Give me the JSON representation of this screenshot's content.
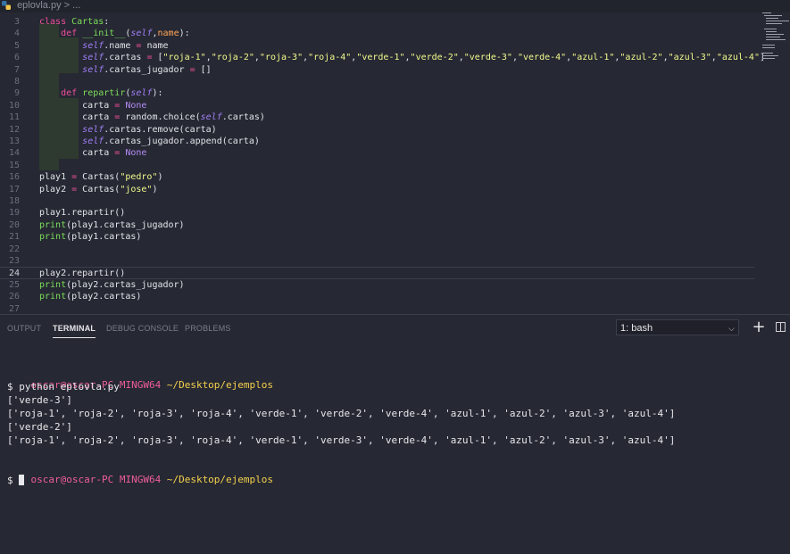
{
  "breadcrumb": {
    "file": "eplovla.py",
    "sep": ">",
    "more": "..."
  },
  "editor": {
    "lines": [
      {
        "n": "3",
        "tokens": [
          [
            "kw",
            "class "
          ],
          [
            "fn",
            "Cartas"
          ],
          [
            "",
            ":"
          ]
        ]
      },
      {
        "n": "4",
        "tokens": [
          [
            "",
            "    "
          ],
          [
            "kw",
            "def "
          ],
          [
            "fn",
            "__init__"
          ],
          [
            "",
            "("
          ],
          [
            "sf",
            "self"
          ],
          [
            "",
            ","
          ],
          [
            "pr",
            "name"
          ],
          [
            "",
            "):"
          ]
        ]
      },
      {
        "n": "5",
        "tokens": [
          [
            "",
            "        "
          ],
          [
            "sf",
            "self"
          ],
          [
            "",
            ".name "
          ],
          [
            "op",
            "="
          ],
          [
            "",
            " name"
          ]
        ]
      },
      {
        "n": "6",
        "tokens": [
          [
            "",
            "        "
          ],
          [
            "sf",
            "self"
          ],
          [
            "",
            ".cartas "
          ],
          [
            "op",
            "="
          ],
          [
            "",
            " ["
          ],
          [
            "st",
            "\"roja-1\""
          ],
          [
            "",
            ","
          ],
          [
            "st",
            "\"roja-2\""
          ],
          [
            "",
            ","
          ],
          [
            "st",
            "\"roja-3\""
          ],
          [
            "",
            ","
          ],
          [
            "st",
            "\"roja-4\""
          ],
          [
            "",
            ","
          ],
          [
            "st",
            "\"verde-1\""
          ],
          [
            "",
            ","
          ],
          [
            "st",
            "\"verde-2\""
          ],
          [
            "",
            ","
          ],
          [
            "st",
            "\"verde-3\""
          ],
          [
            "",
            ","
          ],
          [
            "st",
            "\"verde-4\""
          ],
          [
            "",
            ","
          ],
          [
            "st",
            "\"azul-1\""
          ],
          [
            "",
            ","
          ],
          [
            "st",
            "\"azul-2\""
          ],
          [
            "",
            ","
          ],
          [
            "st",
            "\"azul-3\""
          ],
          [
            "",
            ","
          ],
          [
            "st",
            "\"azul-4\""
          ],
          [
            "",
            "]"
          ]
        ]
      },
      {
        "n": "7",
        "tokens": [
          [
            "",
            "        "
          ],
          [
            "sf",
            "self"
          ],
          [
            "",
            ".cartas_jugador "
          ],
          [
            "op",
            "="
          ],
          [
            "",
            " []"
          ]
        ]
      },
      {
        "n": "8",
        "tokens": []
      },
      {
        "n": "9",
        "tokens": [
          [
            "",
            "    "
          ],
          [
            "kw",
            "def "
          ],
          [
            "fn",
            "repartir"
          ],
          [
            "",
            "("
          ],
          [
            "sf",
            "self"
          ],
          [
            "",
            "):"
          ]
        ]
      },
      {
        "n": "10",
        "tokens": [
          [
            "",
            "        carta "
          ],
          [
            "op",
            "="
          ],
          [
            "",
            " "
          ],
          [
            "cn",
            "None"
          ]
        ]
      },
      {
        "n": "11",
        "tokens": [
          [
            "",
            "        carta "
          ],
          [
            "op",
            "="
          ],
          [
            "",
            " random.choice("
          ],
          [
            "sf",
            "self"
          ],
          [
            "",
            ".cartas)"
          ]
        ]
      },
      {
        "n": "12",
        "tokens": [
          [
            "",
            "        "
          ],
          [
            "sf",
            "self"
          ],
          [
            "",
            ".cartas.remove(carta)"
          ]
        ]
      },
      {
        "n": "13",
        "tokens": [
          [
            "",
            "        "
          ],
          [
            "sf",
            "self"
          ],
          [
            "",
            ".cartas_jugador.append(carta)"
          ]
        ]
      },
      {
        "n": "14",
        "tokens": [
          [
            "",
            "        carta "
          ],
          [
            "op",
            "="
          ],
          [
            "",
            " "
          ],
          [
            "cn",
            "None"
          ]
        ]
      },
      {
        "n": "15",
        "tokens": []
      },
      {
        "n": "16",
        "tokens": [
          [
            "",
            "play1 "
          ],
          [
            "op",
            "="
          ],
          [
            "",
            " Cartas("
          ],
          [
            "st",
            "\"pedro\""
          ],
          [
            "",
            ")"
          ]
        ]
      },
      {
        "n": "17",
        "tokens": [
          [
            "",
            "play2 "
          ],
          [
            "op",
            "="
          ],
          [
            "",
            " Cartas("
          ],
          [
            "st",
            "\"jose\""
          ],
          [
            "",
            ")"
          ]
        ]
      },
      {
        "n": "18",
        "tokens": []
      },
      {
        "n": "19",
        "tokens": [
          [
            "",
            "play1.repartir()"
          ]
        ]
      },
      {
        "n": "20",
        "tokens": [
          [
            "fn",
            "print"
          ],
          [
            "",
            "(play1.cartas_jugador)"
          ]
        ]
      },
      {
        "n": "21",
        "tokens": [
          [
            "fn",
            "print"
          ],
          [
            "",
            "(play1.cartas)"
          ]
        ]
      },
      {
        "n": "22",
        "tokens": []
      },
      {
        "n": "23",
        "tokens": []
      },
      {
        "n": "24",
        "tokens": [
          [
            "",
            "play2.repartir()"
          ]
        ]
      },
      {
        "n": "25",
        "tokens": [
          [
            "fn",
            "print"
          ],
          [
            "",
            "(play2.cartas_jugador)"
          ]
        ]
      },
      {
        "n": "26",
        "tokens": [
          [
            "fn",
            "print"
          ],
          [
            "",
            "(play2.cartas)"
          ]
        ]
      },
      {
        "n": "27",
        "tokens": []
      }
    ],
    "current_line": "24"
  },
  "panel": {
    "tabs": [
      "OUTPUT",
      "TERMINAL",
      "DEBUG CONSOLE",
      "PROBLEMS"
    ],
    "active_tab": "TERMINAL",
    "terminal_select": "1: bash",
    "plus_label": "+"
  },
  "terminal": {
    "prompt1": {
      "user": "oscar@oscar-PC",
      "host": "MINGW64",
      "path": "~/Desktop/ejemplos"
    },
    "command": "$ python eplovla.py",
    "output": [
      "['verde-3']",
      "['roja-1', 'roja-2', 'roja-3', 'roja-4', 'verde-1', 'verde-2', 'verde-4', 'azul-1', 'azul-2', 'azul-3', 'azul-4']",
      "['verde-2']",
      "['roja-1', 'roja-2', 'roja-3', 'roja-4', 'verde-1', 'verde-3', 'verde-4', 'azul-1', 'azul-2', 'azul-3', 'azul-4']"
    ],
    "prompt2": {
      "user": "oscar@oscar-PC",
      "host": "MINGW64",
      "path": "~/Desktop/ejemplos"
    },
    "final_prompt": "$ "
  },
  "colors": {
    "background": "#262833",
    "keyword": "#f0509b",
    "function": "#7cde5a",
    "self": "#a07ff5",
    "string": "#f1fa8c"
  }
}
